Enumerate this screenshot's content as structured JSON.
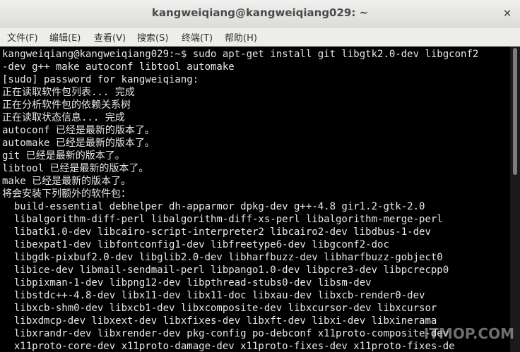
{
  "window": {
    "title": "kangweiqiang@kangweiqiang029: ~",
    "close_glyph": "✕"
  },
  "menu": {
    "items": [
      "文件(F)",
      "编辑(E)",
      "查看(V)",
      "搜索(S)",
      "终端(T)",
      "帮助(H)"
    ]
  },
  "terminal": {
    "lines": [
      "kangweiqiang@kangweiqiang029:~$ sudo apt-get install git libgtk2.0-dev libgconf2",
      "-dev g++ make autoconf libtool automake",
      "[sudo] password for kangweiqiang:",
      "正在读取软件包列表... 完成",
      "正在分析软件包的依赖关系树",
      "正在读取状态信息... 完成",
      "autoconf 已经是最新的版本了。",
      "automake 已经是最新的版本了。",
      "git 已经是最新的版本了。",
      "libtool 已经是最新的版本了。",
      "make 已经是最新的版本了。",
      "将会安装下列额外的软件包：",
      "  build-essential debhelper dh-apparmor dpkg-dev g++-4.8 gir1.2-gtk-2.0",
      "  libalgorithm-diff-perl libalgorithm-diff-xs-perl libalgorithm-merge-perl",
      "  libatk1.0-dev libcairo-script-interpreter2 libcairo2-dev libdbus-1-dev",
      "  libexpat1-dev libfontconfig1-dev libfreetype6-dev libgconf2-doc",
      "  libgdk-pixbuf2.0-dev libglib2.0-dev libharfbuzz-dev libharfbuzz-gobject0",
      "  libice-dev libmail-sendmail-perl libpango1.0-dev libpcre3-dev libpcrecpp0",
      "  libpixman-1-dev libpng12-dev libpthread-stubs0-dev libsm-dev",
      "  libstdc++-4.8-dev libx11-dev libx11-doc libxau-dev libxcb-render0-dev",
      "  libxcb-shm0-dev libxcb1-dev libxcomposite-dev libxcursor-dev libxcursor",
      "  libxdmcp-dev libxext-dev libxfixes-dev libxft-dev libxi-dev libxinerama",
      "  libxrandr-dev libxrender-dev pkg-config po-debconf x11proto-composite-dev",
      "  x11proto-core-dev x11proto-damage-dev x11proto-fixes-dev x11proto-fixes-de"
    ]
  },
  "watermark": {
    "text": "ITMOP.COM"
  }
}
